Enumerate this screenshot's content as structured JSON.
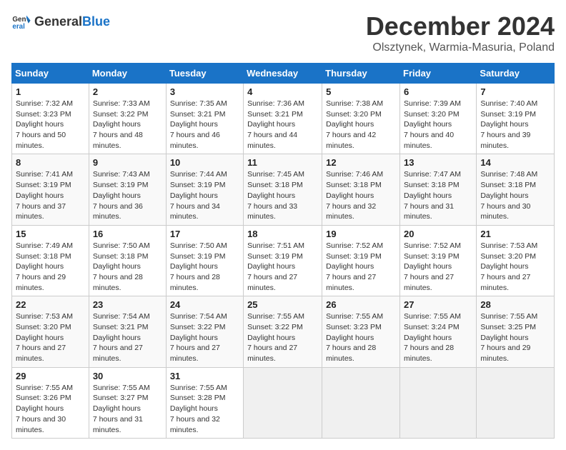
{
  "logo": {
    "general": "General",
    "blue": "Blue"
  },
  "header": {
    "month": "December 2024",
    "location": "Olsztynek, Warmia-Masuria, Poland"
  },
  "weekdays": [
    "Sunday",
    "Monday",
    "Tuesday",
    "Wednesday",
    "Thursday",
    "Friday",
    "Saturday"
  ],
  "weeks": [
    [
      {
        "day": "1",
        "sunrise": "7:32 AM",
        "sunset": "3:23 PM",
        "daylight": "7 hours and 50 minutes."
      },
      {
        "day": "2",
        "sunrise": "7:33 AM",
        "sunset": "3:22 PM",
        "daylight": "7 hours and 48 minutes."
      },
      {
        "day": "3",
        "sunrise": "7:35 AM",
        "sunset": "3:21 PM",
        "daylight": "7 hours and 46 minutes."
      },
      {
        "day": "4",
        "sunrise": "7:36 AM",
        "sunset": "3:21 PM",
        "daylight": "7 hours and 44 minutes."
      },
      {
        "day": "5",
        "sunrise": "7:38 AM",
        "sunset": "3:20 PM",
        "daylight": "7 hours and 42 minutes."
      },
      {
        "day": "6",
        "sunrise": "7:39 AM",
        "sunset": "3:20 PM",
        "daylight": "7 hours and 40 minutes."
      },
      {
        "day": "7",
        "sunrise": "7:40 AM",
        "sunset": "3:19 PM",
        "daylight": "7 hours and 39 minutes."
      }
    ],
    [
      {
        "day": "8",
        "sunrise": "7:41 AM",
        "sunset": "3:19 PM",
        "daylight": "7 hours and 37 minutes."
      },
      {
        "day": "9",
        "sunrise": "7:43 AM",
        "sunset": "3:19 PM",
        "daylight": "7 hours and 36 minutes."
      },
      {
        "day": "10",
        "sunrise": "7:44 AM",
        "sunset": "3:19 PM",
        "daylight": "7 hours and 34 minutes."
      },
      {
        "day": "11",
        "sunrise": "7:45 AM",
        "sunset": "3:18 PM",
        "daylight": "7 hours and 33 minutes."
      },
      {
        "day": "12",
        "sunrise": "7:46 AM",
        "sunset": "3:18 PM",
        "daylight": "7 hours and 32 minutes."
      },
      {
        "day": "13",
        "sunrise": "7:47 AM",
        "sunset": "3:18 PM",
        "daylight": "7 hours and 31 minutes."
      },
      {
        "day": "14",
        "sunrise": "7:48 AM",
        "sunset": "3:18 PM",
        "daylight": "7 hours and 30 minutes."
      }
    ],
    [
      {
        "day": "15",
        "sunrise": "7:49 AM",
        "sunset": "3:18 PM",
        "daylight": "7 hours and 29 minutes."
      },
      {
        "day": "16",
        "sunrise": "7:50 AM",
        "sunset": "3:18 PM",
        "daylight": "7 hours and 28 minutes."
      },
      {
        "day": "17",
        "sunrise": "7:50 AM",
        "sunset": "3:19 PM",
        "daylight": "7 hours and 28 minutes."
      },
      {
        "day": "18",
        "sunrise": "7:51 AM",
        "sunset": "3:19 PM",
        "daylight": "7 hours and 27 minutes."
      },
      {
        "day": "19",
        "sunrise": "7:52 AM",
        "sunset": "3:19 PM",
        "daylight": "7 hours and 27 minutes."
      },
      {
        "day": "20",
        "sunrise": "7:52 AM",
        "sunset": "3:19 PM",
        "daylight": "7 hours and 27 minutes."
      },
      {
        "day": "21",
        "sunrise": "7:53 AM",
        "sunset": "3:20 PM",
        "daylight": "7 hours and 27 minutes."
      }
    ],
    [
      {
        "day": "22",
        "sunrise": "7:53 AM",
        "sunset": "3:20 PM",
        "daylight": "7 hours and 27 minutes."
      },
      {
        "day": "23",
        "sunrise": "7:54 AM",
        "sunset": "3:21 PM",
        "daylight": "7 hours and 27 minutes."
      },
      {
        "day": "24",
        "sunrise": "7:54 AM",
        "sunset": "3:22 PM",
        "daylight": "7 hours and 27 minutes."
      },
      {
        "day": "25",
        "sunrise": "7:55 AM",
        "sunset": "3:22 PM",
        "daylight": "7 hours and 27 minutes."
      },
      {
        "day": "26",
        "sunrise": "7:55 AM",
        "sunset": "3:23 PM",
        "daylight": "7 hours and 28 minutes."
      },
      {
        "day": "27",
        "sunrise": "7:55 AM",
        "sunset": "3:24 PM",
        "daylight": "7 hours and 28 minutes."
      },
      {
        "day": "28",
        "sunrise": "7:55 AM",
        "sunset": "3:25 PM",
        "daylight": "7 hours and 29 minutes."
      }
    ],
    [
      {
        "day": "29",
        "sunrise": "7:55 AM",
        "sunset": "3:26 PM",
        "daylight": "7 hours and 30 minutes."
      },
      {
        "day": "30",
        "sunrise": "7:55 AM",
        "sunset": "3:27 PM",
        "daylight": "7 hours and 31 minutes."
      },
      {
        "day": "31",
        "sunrise": "7:55 AM",
        "sunset": "3:28 PM",
        "daylight": "7 hours and 32 minutes."
      },
      null,
      null,
      null,
      null
    ]
  ]
}
